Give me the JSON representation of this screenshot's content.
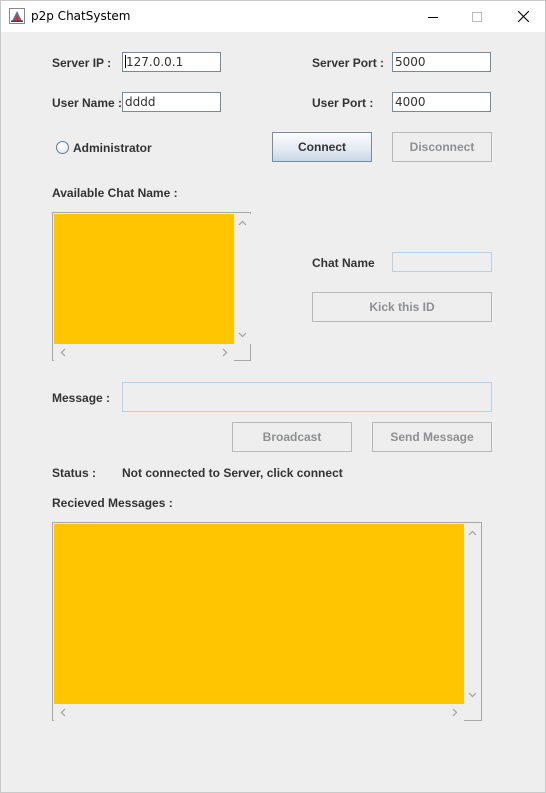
{
  "window": {
    "title": "p2p ChatSystem",
    "icon": "java-cup-icon"
  },
  "connection": {
    "server_ip_label": "Server IP :",
    "server_ip_value": "127.0.0.1",
    "server_port_label": "Server Port :",
    "server_port_value": "5000",
    "user_name_label": "User Name :",
    "user_name_value": "dddd",
    "user_port_label": "User Port :",
    "user_port_value": "4000",
    "administrator_label": "Administrator",
    "administrator_checked": false,
    "connect_label": "Connect",
    "disconnect_label": "Disconnect"
  },
  "chat_names": {
    "label": "Available Chat Name :",
    "items": []
  },
  "admin": {
    "chat_name_label": "Chat Name",
    "chat_name_value": "",
    "kick_label": "Kick this ID"
  },
  "message": {
    "label": "Message :",
    "value": "",
    "broadcast_label": "Broadcast",
    "send_label": "Send Message"
  },
  "status": {
    "label": "Status :",
    "text": "Not connected to Server, click connect"
  },
  "received": {
    "label": "Recieved Messages :",
    "messages": []
  },
  "colors": {
    "list_background": "#ffc600",
    "window_background": "#eeeeee",
    "disabled_text": "#8e8f91"
  }
}
